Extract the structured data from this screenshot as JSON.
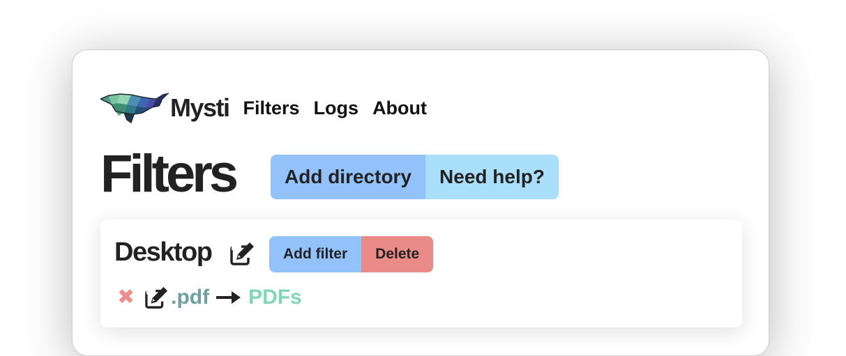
{
  "header": {
    "brand": "Mysti",
    "nav": [
      {
        "label": "Filters"
      },
      {
        "label": "Logs"
      },
      {
        "label": "About"
      }
    ]
  },
  "page": {
    "title": "Filters",
    "add_directory_label": "Add directory",
    "help_label": "Need help?"
  },
  "directories": [
    {
      "name": "Desktop",
      "add_filter_label": "Add filter",
      "delete_label": "Delete",
      "filters": [
        {
          "extension": ".pdf",
          "target": "PDFs"
        }
      ]
    }
  ],
  "colors": {
    "primary_button": "#93c2fb",
    "info_button": "#aadffb",
    "danger_button": "#ea8b87",
    "remove_icon": "#ec8f8c",
    "extension_text": "#6fa0a0",
    "target_text": "#7fd8b5"
  },
  "icons": {
    "logo": "whale-logo-icon",
    "edit": "edit-icon",
    "remove": "close-x-icon",
    "arrow": "arrow-right-icon"
  }
}
